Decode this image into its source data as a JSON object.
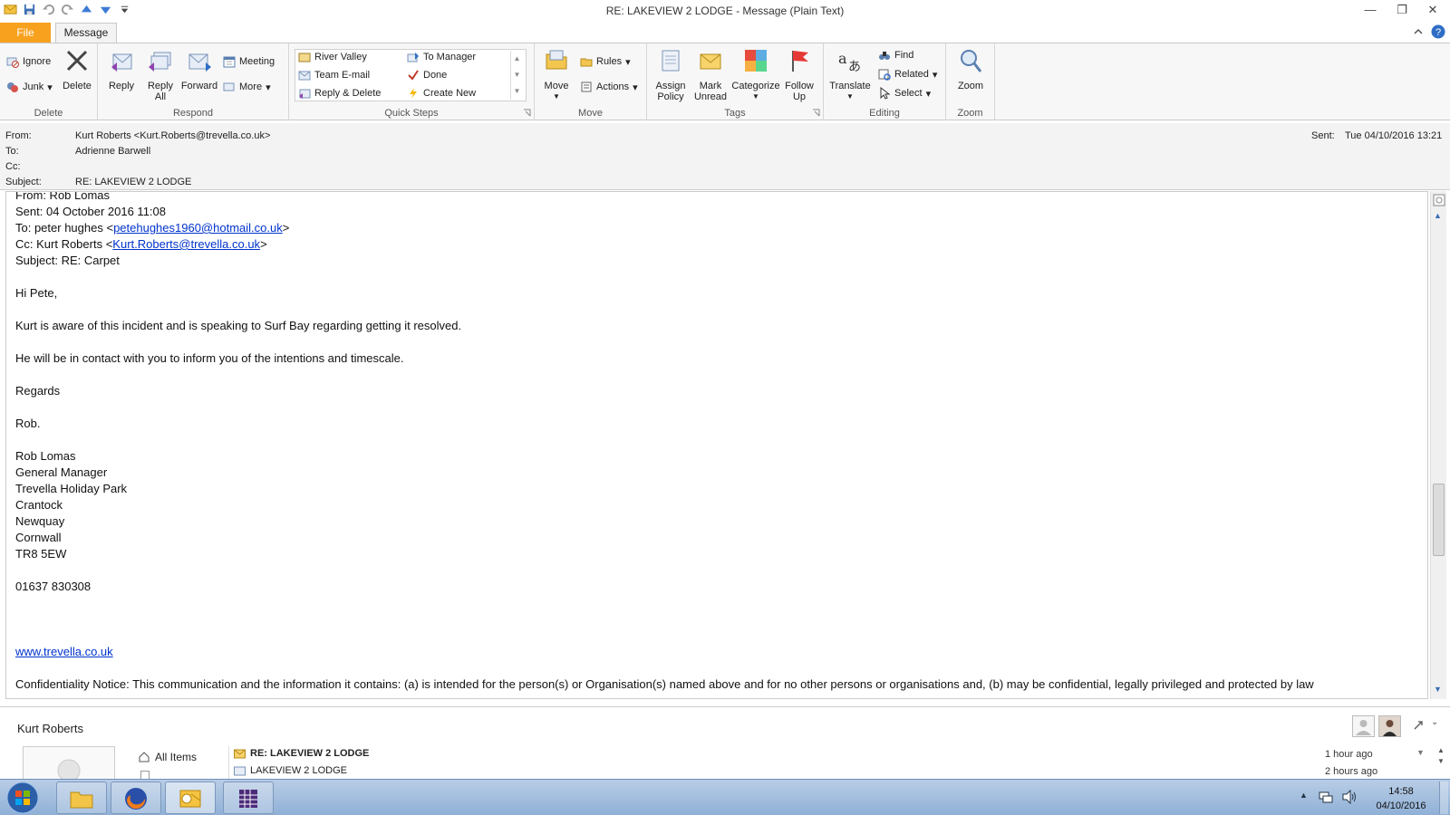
{
  "window": {
    "title": "RE: LAKEVIEW 2 LODGE  -  Message (Plain Text)",
    "controls": [
      "minimize",
      "restore",
      "close"
    ]
  },
  "tabs": {
    "file": "File",
    "message": "Message"
  },
  "ribbon": {
    "delete": {
      "label": "Delete",
      "ignore": "Ignore",
      "junk": "Junk",
      "delete_btn": "Delete"
    },
    "respond": {
      "label": "Respond",
      "reply": "Reply",
      "reply_all_1": "Reply",
      "reply_all_2": "All",
      "forward": "Forward",
      "meeting": "Meeting",
      "more": "More"
    },
    "quick_steps": {
      "label": "Quick Steps",
      "items": [
        "River Valley",
        "To Manager",
        "Team E-mail",
        "Done",
        "Reply & Delete",
        "Create New"
      ]
    },
    "move": {
      "label": "Move",
      "move_btn": "Move",
      "rules": "Rules",
      "actions": "Actions"
    },
    "tags": {
      "label": "Tags",
      "assign_1": "Assign",
      "assign_2": "Policy",
      "mark_1": "Mark",
      "mark_2": "Unread",
      "categorize": "Categorize",
      "follow_1": "Follow",
      "follow_2": "Up"
    },
    "editing": {
      "label": "Editing",
      "translate": "Translate",
      "find": "Find",
      "related": "Related",
      "select": "Select"
    },
    "zoom": {
      "label": "Zoom",
      "zoom_btn": "Zoom"
    }
  },
  "header": {
    "from_label": "From:",
    "from_value": "Kurt Roberts <Kurt.Roberts@trevella.co.uk>",
    "to_label": "To:",
    "to_value": "Adrienne Barwell",
    "cc_label": "Cc:",
    "subject_label": "Subject:",
    "subject_value": "RE: LAKEVIEW 2 LODGE",
    "sent_label": "Sent:",
    "sent_value": "Tue 04/10/2016 13:21"
  },
  "body": {
    "from_line": "From: Rob Lomas",
    "sent_line": "Sent: 04 October 2016 11:08",
    "to_prefix": "To: peter hughes <",
    "to_email": "petehughes1960@hotmail.co.uk",
    "to_suffix": ">",
    "cc_prefix": "Cc: Kurt Roberts <",
    "cc_email": "Kurt.Roberts@trevella.co.uk",
    "cc_suffix": ">",
    "subject_line": "Subject: RE: Carpet",
    "greeting": "Hi Pete,",
    "para1": "Kurt is aware of this incident and is speaking to Surf Bay regarding getting it resolved.",
    "para2": "He will be in contact with you to inform you of the intentions and timescale.",
    "regards": "Regards",
    "signoff": "Rob.",
    "sig_lines": [
      "Rob Lomas",
      "General Manager",
      "Trevella Holiday Park",
      "Crantock",
      "Newquay",
      "Cornwall",
      "TR8 5EW"
    ],
    "phone": "01637 830308",
    "website": "www.trevella.co.uk",
    "confidentiality": "Confidentiality Notice: This communication and the information it contains: (a) is intended for the person(s) or Organisation(s) named above and for no other persons or organisations and, (b) may be confidential, legally privileged and protected by law"
  },
  "people_pane": {
    "name": "Kurt Roberts",
    "all_items": "All Items",
    "items": [
      {
        "subject": "RE: LAKEVIEW 2 LODGE",
        "time": "1 hour ago"
      },
      {
        "subject": "LAKEVIEW 2 LODGE",
        "time": "2 hours ago"
      }
    ]
  },
  "taskbar": {
    "time": "14:58",
    "date": "04/10/2016"
  },
  "colors": {
    "file_tab": "#f8a11e",
    "link": "#0033cc",
    "taskbar": "#9fbadf"
  }
}
